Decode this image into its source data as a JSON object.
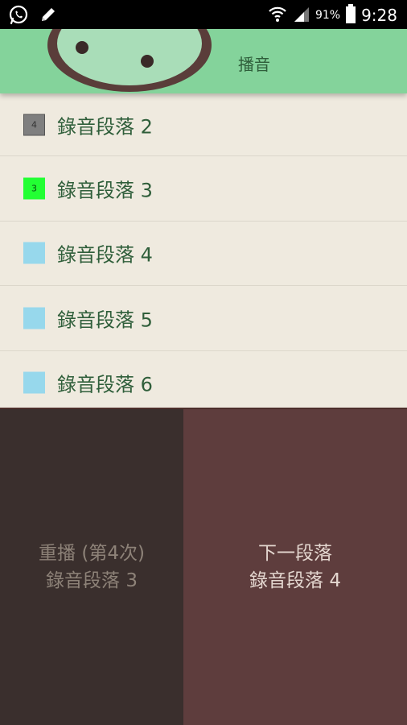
{
  "status_bar": {
    "battery_percent": "91%",
    "time": "9:28",
    "left_icons": [
      "whatsapp-icon",
      "pencil-icon"
    ],
    "right_icons": [
      "wifi-icon",
      "signal-icon",
      "battery-icon"
    ]
  },
  "header": {
    "title": "播音"
  },
  "segments": [
    {
      "label": "錄音段落 2",
      "badge": "4",
      "swatch_color": "#7f7f7f",
      "badge_color": "#333333"
    },
    {
      "label": "錄音段落 3",
      "badge": "3",
      "swatch_color": "#22ff33",
      "badge_color": "#0a4a10"
    },
    {
      "label": "錄音段落 4",
      "badge": "",
      "swatch_color": "#97d8ec",
      "badge_color": ""
    },
    {
      "label": "錄音段落 5",
      "badge": "",
      "swatch_color": "#97d8ec",
      "badge_color": ""
    },
    {
      "label": "錄音段落 6",
      "badge": "",
      "swatch_color": "#97d8ec",
      "badge_color": ""
    }
  ],
  "replay_button": {
    "line1": "重播 (第4次)",
    "line2": "錄音段落 3"
  },
  "next_button": {
    "line1": "下一段落",
    "line2": "錄音段落 4"
  },
  "colors": {
    "header_bg": "#84d39b",
    "list_bg": "#efeadf",
    "replay_bg": "#3a2f2d",
    "next_bg": "#5e3d3d"
  }
}
